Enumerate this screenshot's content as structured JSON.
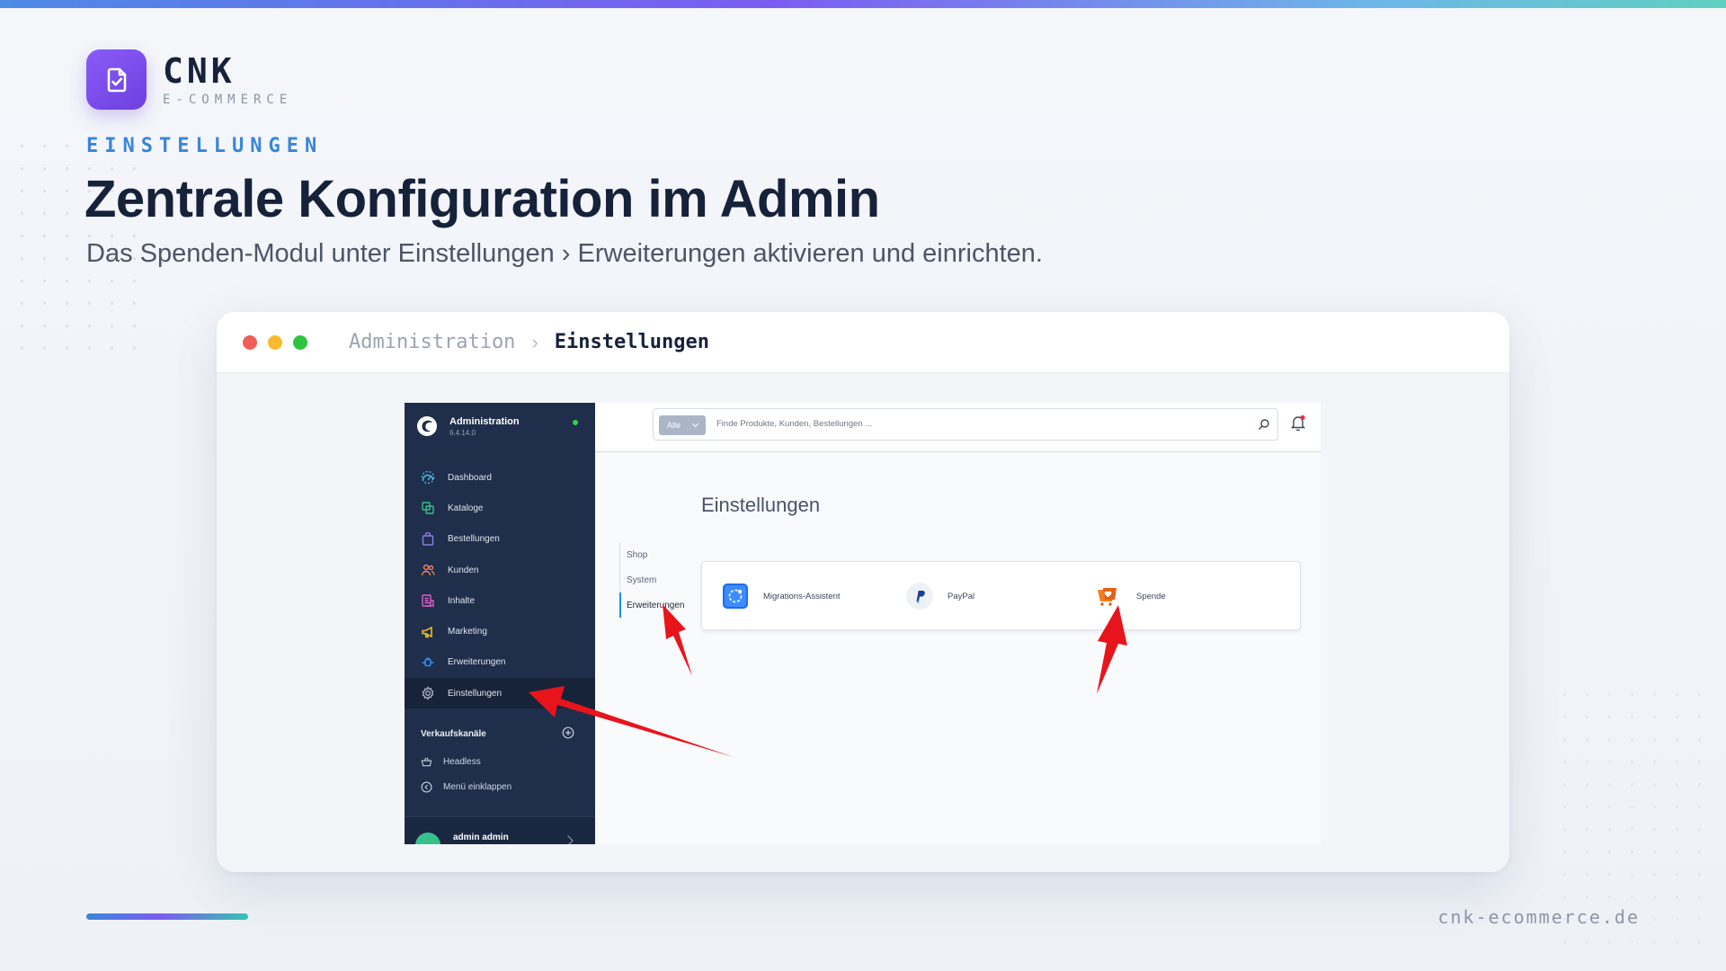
{
  "brand": {
    "name": "CNK",
    "subtitle": "E-COMMERCE"
  },
  "kicker": "EINSTELLUNGEN",
  "headline": "Zentrale Konfiguration im Admin",
  "subline": "Das Spenden-Modul unter Einstellungen › Erweiterungen aktivieren und einrichten.",
  "window": {
    "breadcrumb": {
      "first": "Administration",
      "separator": "›",
      "current": "Einstellungen"
    }
  },
  "admin": {
    "title": "Administration",
    "version": "6.4.14.0",
    "nav": [
      {
        "label": "Dashboard",
        "icon": "dashboard-icon",
        "color": "#4fb7e6"
      },
      {
        "label": "Kataloge",
        "icon": "catalog-icon",
        "color": "#37c08b"
      },
      {
        "label": "Bestellungen",
        "icon": "orders-icon",
        "color": "#8a7de8"
      },
      {
        "label": "Kunden",
        "icon": "customers-icon",
        "color": "#f0845c"
      },
      {
        "label": "Inhalte",
        "icon": "content-icon",
        "color": "#e45cc8"
      },
      {
        "label": "Marketing",
        "icon": "marketing-icon",
        "color": "#f2c21c"
      },
      {
        "label": "Erweiterungen",
        "icon": "extensions-icon",
        "color": "#2a95f0"
      },
      {
        "label": "Einstellungen",
        "icon": "settings-icon",
        "color": "#a9b4c6"
      }
    ],
    "sales_channels_title": "Verkaufskanäle",
    "sales_channels": [
      {
        "label": "Headless",
        "icon": "basket-icon"
      },
      {
        "label": "Menü einklappen",
        "icon": "collapse-icon"
      }
    ],
    "user": "admin admin",
    "search": {
      "scope": "Alle",
      "placeholder": "Finde Produkte, Kunden, Bestellungen ..."
    },
    "page_title": "Einstellungen",
    "tabs": [
      "Shop",
      "System",
      "Erweiterungen"
    ],
    "active_tab": "Erweiterungen",
    "plugins": [
      {
        "label": "Migrations-Assistent",
        "icon": "migration-icon"
      },
      {
        "label": "PayPal",
        "icon": "paypal-icon"
      },
      {
        "label": "Spende",
        "icon": "donation-icon"
      }
    ]
  },
  "footer": {
    "url": "cnk-ecommerce.de"
  },
  "colors": {
    "accent": "#3a86d8",
    "logo": "#7c4ff0",
    "sidebar": "#1f2e4a",
    "arrow": "#e8141c"
  }
}
